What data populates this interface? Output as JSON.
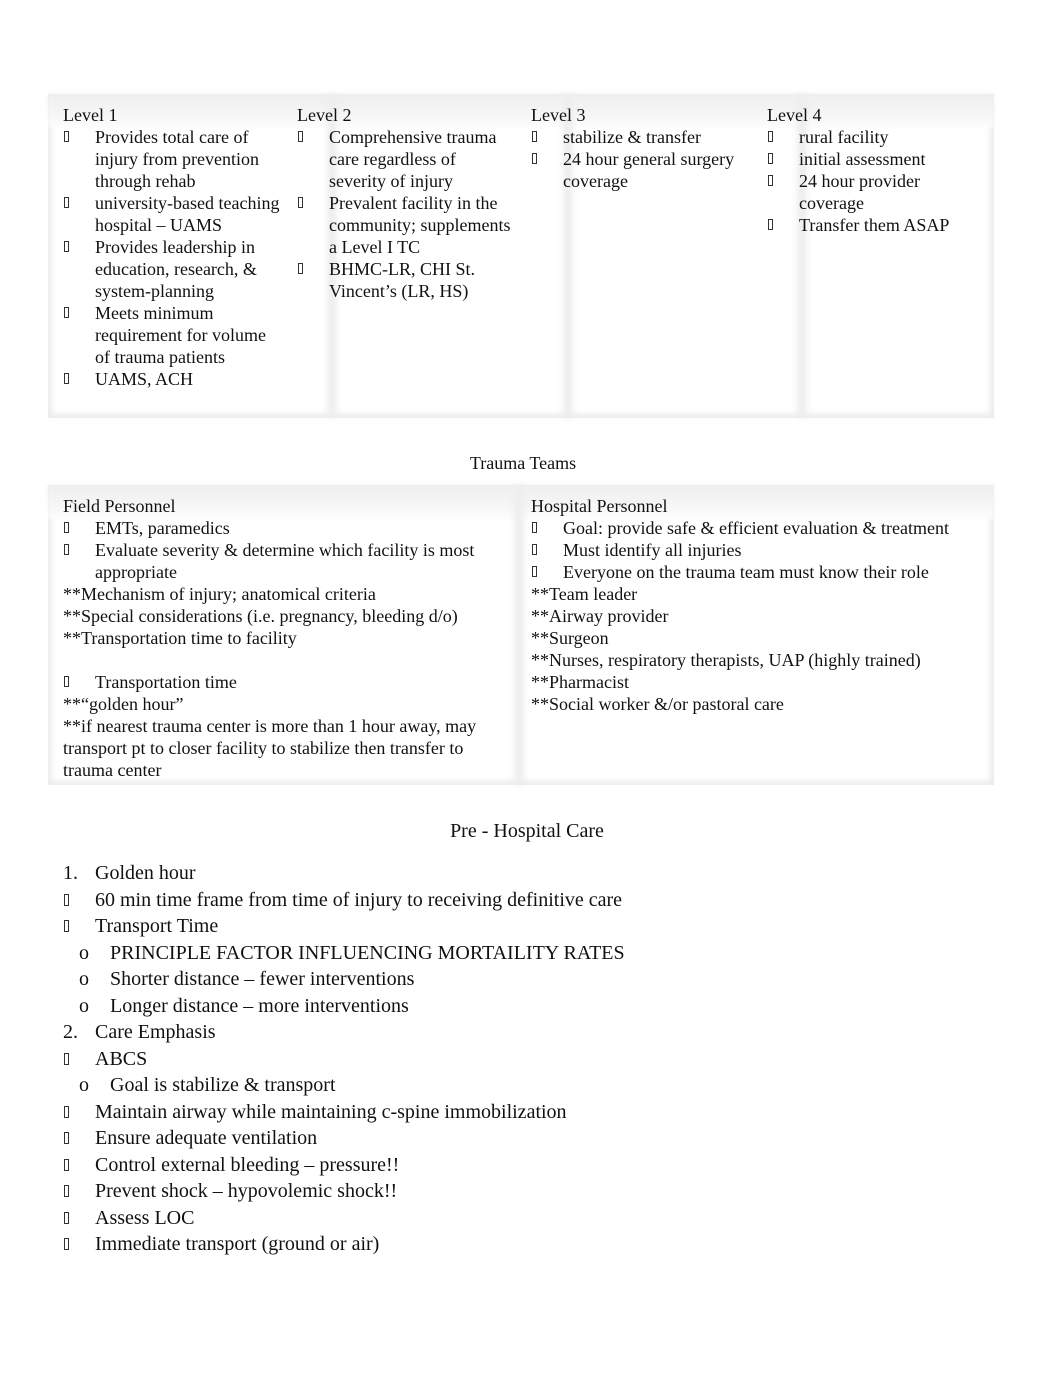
{
  "levels_table": {
    "columns": [
      {
        "heading": "Level 1",
        "items": [
          "Provides total care of injury from prevention through rehab",
          "university-based teaching hospital – UAMS",
          "Provides leadership in education, research, & system-planning",
          "Meets minimum requirement for volume of trauma patients",
          "UAMS, ACH"
        ]
      },
      {
        "heading": "Level 2",
        "items": [
          "Comprehensive trauma care regardless of severity of injury",
          "Prevalent facility in the community; supplements a Level I TC",
          "BHMC-LR, CHI St. Vincent’s (LR, HS)"
        ]
      },
      {
        "heading": "Level 3",
        "items": [
          "stabilize & transfer",
          "24 hour general surgery coverage"
        ]
      },
      {
        "heading": "Level 4",
        "items": [
          "rural facility",
          "initial assessment",
          "24 hour provider coverage",
          "Transfer them ASAP"
        ]
      }
    ]
  },
  "trauma_teams": {
    "title": "Trauma Teams",
    "field": {
      "heading": "Field Personnel",
      "bullets1": [
        "EMTs, paramedics",
        "Evaluate severity & determine which facility is most appropriate"
      ],
      "notes1": [
        "**Mechanism of injury; anatomical criteria",
        "**Special considerations (i.e. pregnancy, bleeding d/o)",
        "**Transportation time to facility"
      ],
      "bullets2": [
        "Transportation time"
      ],
      "notes2": [
        "**“golden hour”",
        "**if nearest trauma center is more than 1 hour away, may transport pt to closer facility to stabilize then transfer to trauma center"
      ]
    },
    "hospital": {
      "heading": "Hospital Personnel",
      "bullets": [
        "Goal: provide safe & efficient evaluation & treatment",
        "Must identify all injuries",
        "Everyone on the trauma team must know their role"
      ],
      "notes": [
        "**Team leader",
        "**Airway provider",
        "**Surgeon",
        "**Nurses, respiratory therapists, UAP (highly trained)",
        "**Pharmacist",
        "**Social worker &/or pastoral care"
      ]
    }
  },
  "pre_hospital": {
    "title": "Pre - Hospital Care",
    "section1": {
      "number": "1.",
      "label": "Golden hour",
      "bullets": [
        "60 min time frame from time of injury to receiving definitive care",
        "Transport Time"
      ],
      "sub_marker": "o",
      "sub_items": [
        "PRINCIPLE FACTOR INFLUENCING MORTAILITY RATES",
        "Shorter distance – fewer interventions",
        "Longer distance – more interventions"
      ]
    },
    "section2": {
      "number": "2.",
      "label": "Care Emphasis",
      "bullet_abcs": "ABCS",
      "sub_marker": "o",
      "sub_items": [
        "Goal is stabilize & transport"
      ],
      "bullets": [
        "Maintain airway while maintaining c-spine immobilization",
        "Ensure adequate ventilation",
        "Control external bleeding – pressure!!",
        "Prevent shock – hypovolemic shock!!",
        "Assess LOC",
        "Immediate transport (ground or air)"
      ]
    }
  }
}
